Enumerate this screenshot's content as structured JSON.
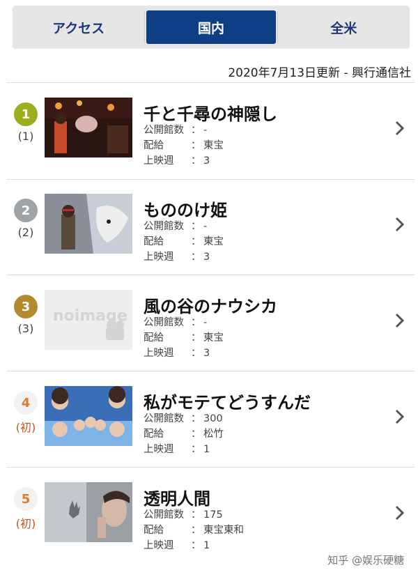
{
  "tabs": [
    {
      "label": "アクセス",
      "active": false
    },
    {
      "label": "国内",
      "active": true
    },
    {
      "label": "全米",
      "active": false
    }
  ],
  "update_text": "2020年7月13日更新 - 興行通信社",
  "labels": {
    "theaters": "公開館数",
    "distributor": "配給",
    "weeks": "上映週",
    "colon": "："
  },
  "movies": [
    {
      "rank": "1",
      "prev": "(1)",
      "title": "千と千尋の神隠し",
      "theaters": "-",
      "distributor": "東宝",
      "weeks": "3",
      "badge_color": "#9aae1e",
      "new": false,
      "thumb": "spirited-away-still"
    },
    {
      "rank": "2",
      "prev": "(2)",
      "title": "もののけ姫",
      "theaters": "-",
      "distributor": "東宝",
      "weeks": "3",
      "badge_color": "#9fa3a6",
      "new": false,
      "thumb": "princess-mononoke-still"
    },
    {
      "rank": "3",
      "prev": "(3)",
      "title": "風の谷のナウシカ",
      "theaters": "-",
      "distributor": "東宝",
      "weeks": "3",
      "badge_color": "#b48a2f",
      "new": false,
      "thumb": "no-image"
    },
    {
      "rank": "4",
      "prev": "(初)",
      "title": "私がモテてどうすんだ",
      "theaters": "300",
      "distributor": "松竹",
      "weeks": "1",
      "badge_color": "#e07a2c",
      "new": true,
      "thumb": "kiss-him-poster"
    },
    {
      "rank": "5",
      "prev": "(初)",
      "title": "透明人間",
      "theaters": "175",
      "distributor": "東宝東和",
      "weeks": "1",
      "badge_color": "#e07a2c",
      "new": true,
      "thumb": "invisible-man-still"
    }
  ],
  "no_image_text": "noimage",
  "watermark": "知乎 @娱乐硬糖"
}
